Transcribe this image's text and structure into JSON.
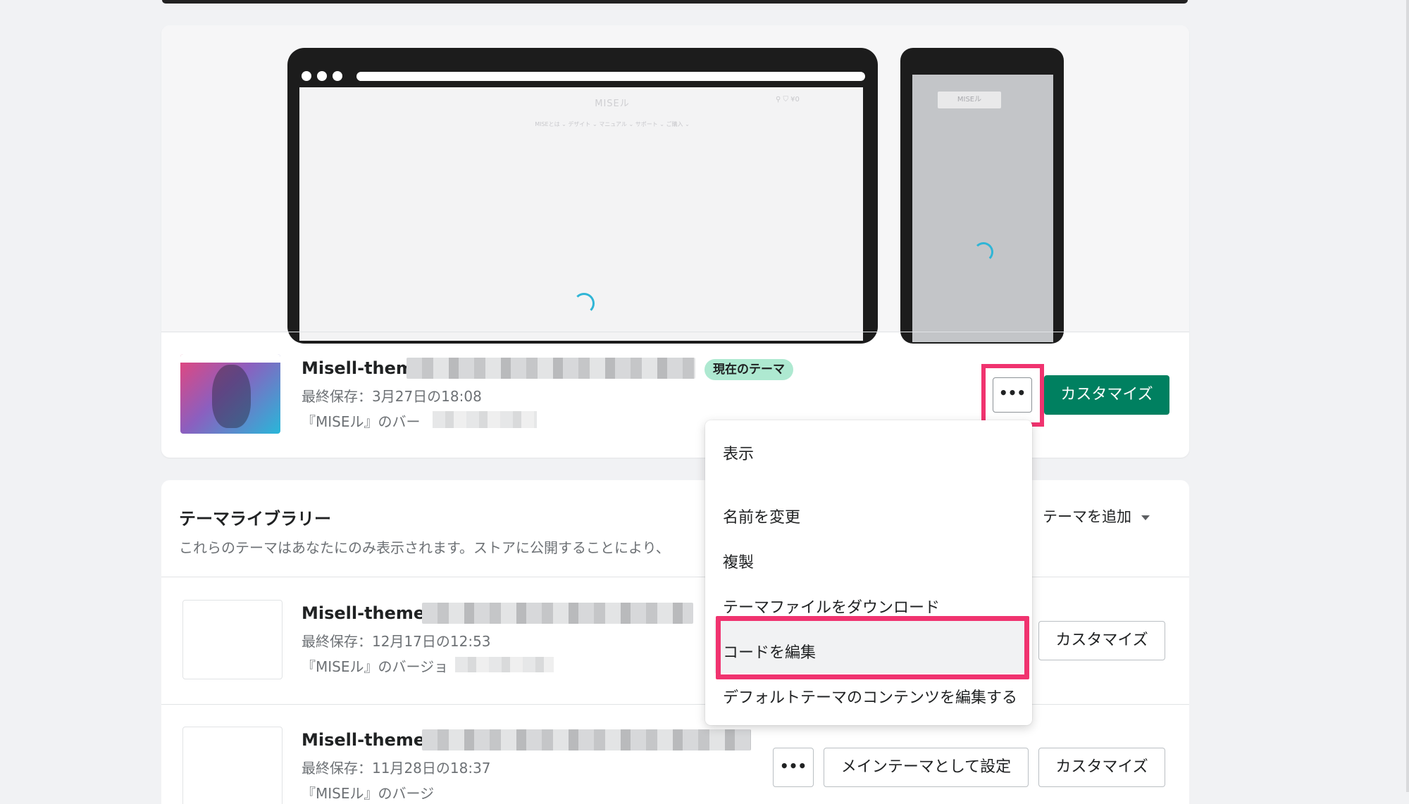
{
  "current_theme": {
    "preview": {
      "desktop_logo": "MISEル",
      "desktop_nav": "MISEとは ⌄   デザイト ⌄   マニュアル ⌄   サポート ⌄   ご購入 ⌄",
      "desktop_icons": "⚲  ⛉  ¥0",
      "phone_logo": "MISEル"
    },
    "name": "Misell-theme",
    "badge": "現在のテーマ",
    "last_saved": "最終保存：3月27日の18:08",
    "version": "『MISEル』のバー",
    "more_button": "•••",
    "customize_button": "カスタマイズ"
  },
  "dropdown_menu": {
    "items": [
      "表示",
      "名前を変更",
      "複製",
      "テーマファイルをダウンロード",
      "コードを編集",
      "デフォルトテーマのコンテンツを編集する"
    ]
  },
  "library": {
    "title": "テーマライブラリー",
    "description": "これらのテーマはあなたにのみ表示されます。ストアに公開することにより、",
    "add_theme": "テーマを追加",
    "themes": [
      {
        "name": "Misell-theme-1",
        "last_saved": "最終保存：12月17日の12:53",
        "version": "『MISEル』のバージョ",
        "customize_button": "カスタマイズ"
      },
      {
        "name": "Misell-theme-1",
        "last_saved": "最終保存：11月28日の18:37",
        "version": "『MISEル』のバージ",
        "more_button": "•••",
        "publish_button": "メインテーマとして設定",
        "customize_button": "カスタマイズ"
      }
    ]
  },
  "colors": {
    "primary": "#008060",
    "highlight": "#f0336f",
    "badge": "#aee9d1",
    "spinner": "#2fb5d6"
  }
}
